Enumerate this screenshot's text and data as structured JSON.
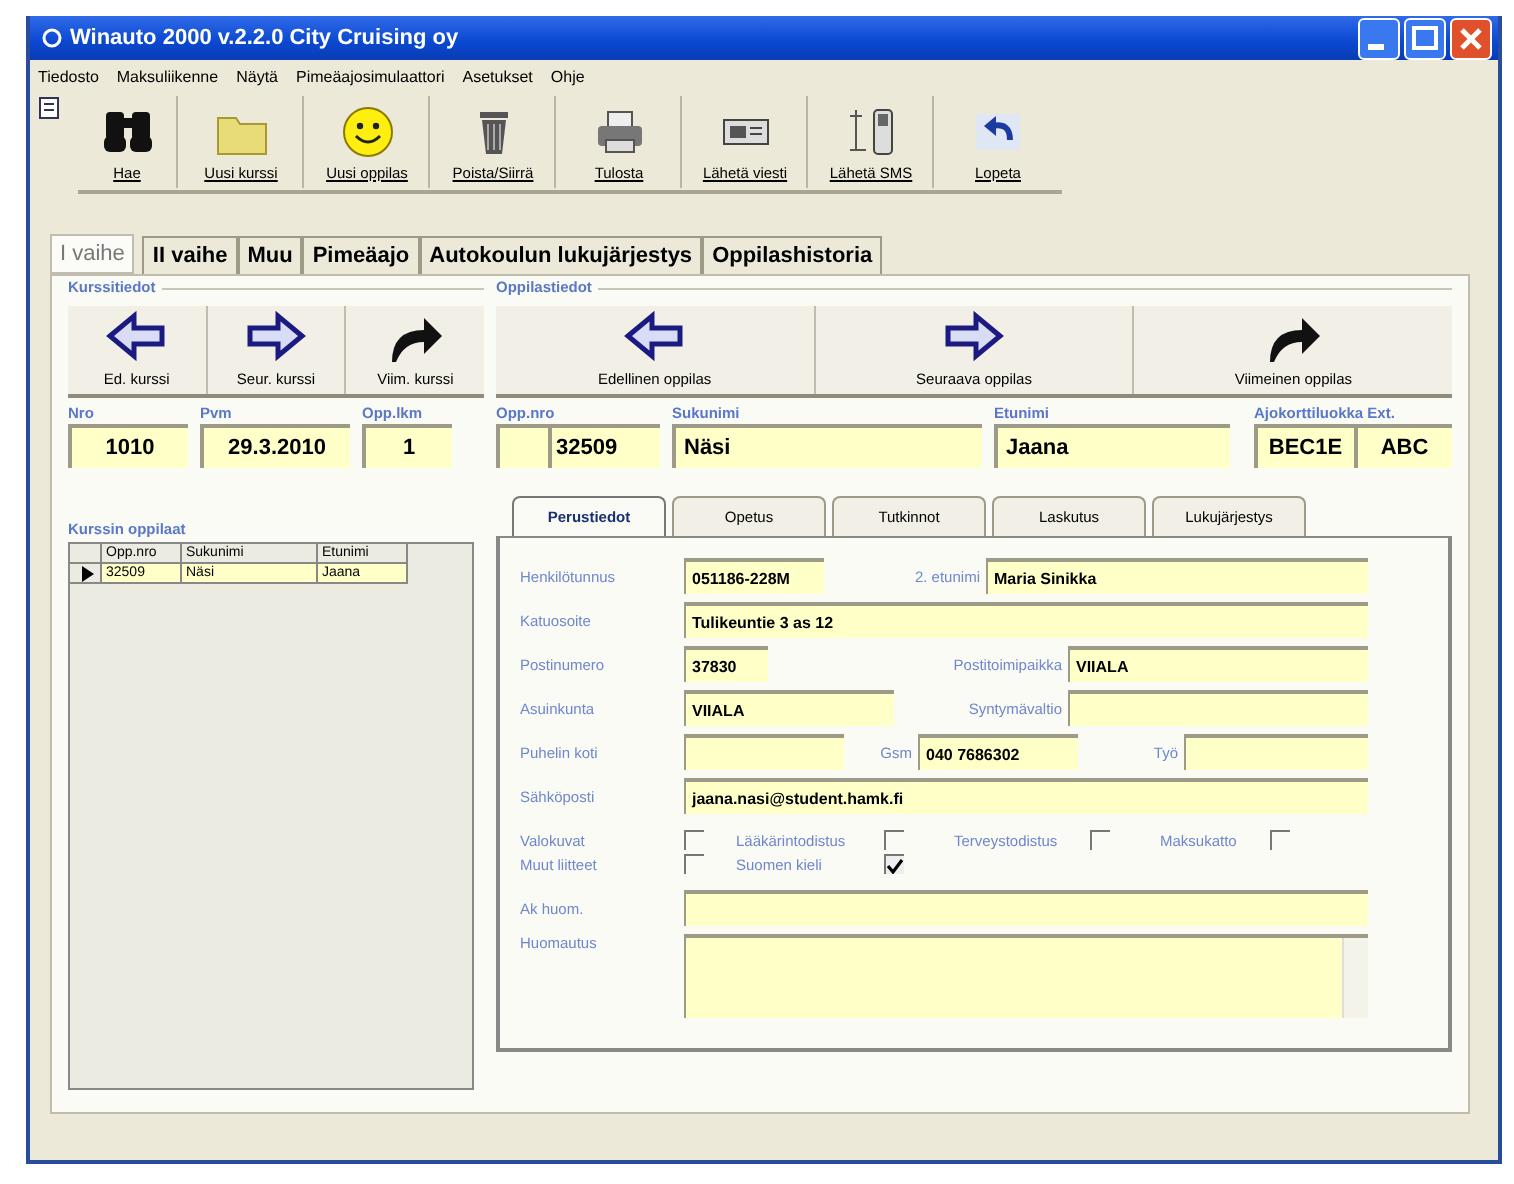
{
  "window": {
    "title": "Winauto 2000 v.2.2.0  City Cruising oy"
  },
  "menu": [
    "Tiedosto",
    "Maksuliikenne",
    "Näytä",
    "Pimeäajosimulaattori",
    "Asetukset",
    "Ohje"
  ],
  "toolbar": [
    {
      "kind": "search",
      "label": "Hae"
    },
    {
      "kind": "folder",
      "label": "Uusi kurssi"
    },
    {
      "kind": "smiley",
      "label": "Uusi oppilas"
    },
    {
      "kind": "trash",
      "label": "Poista/Siirrä"
    },
    {
      "kind": "printer",
      "label": "Tulosta"
    },
    {
      "kind": "message",
      "label": "Lähetä viesti"
    },
    {
      "kind": "phone",
      "label": "Lähetä SMS"
    },
    {
      "kind": "undo",
      "label": "Lopeta"
    }
  ],
  "tabs": [
    {
      "label": "I vaihe",
      "selected": true
    },
    {
      "label": "II vaihe",
      "selected": false
    },
    {
      "label": "Muu",
      "selected": false
    },
    {
      "label": "Pimeäajo",
      "selected": false
    },
    {
      "label": "Autokoulun lukujärjestys",
      "selected": false
    },
    {
      "label": "Oppilashistoria",
      "selected": false
    }
  ],
  "course": {
    "title": "Kurssitiedot",
    "buttons": [
      {
        "kind": "prev",
        "label": "Ed. kurssi"
      },
      {
        "kind": "next",
        "label": "Seur. kurssi"
      },
      {
        "kind": "last",
        "label": "Viim. kurssi"
      }
    ],
    "fields": [
      {
        "label": "Nro",
        "value": "1010"
      },
      {
        "label": "Pvm",
        "value": "29.3.2010"
      },
      {
        "label": "Opp.lkm",
        "value": "1"
      }
    ],
    "students": {
      "title": "Kurssin oppilaat",
      "columns": [
        "Opp.nro",
        "Sukunimi",
        "Etunimi"
      ],
      "rows": [
        {
          "cells": [
            "32509",
            "Näsi",
            "Jaana"
          ],
          "selected": true
        }
      ]
    }
  },
  "student": {
    "title": "Oppilastiedot",
    "buttons": [
      {
        "kind": "prev",
        "label": "Edellinen oppilas"
      },
      {
        "kind": "next",
        "label": "Seuraava oppilas"
      },
      {
        "kind": "last",
        "label": "Viimeinen oppilas"
      }
    ],
    "fields": [
      {
        "label": "Opp.nro",
        "value": "32509"
      },
      {
        "label": "Sukunimi",
        "value": "Näsi"
      },
      {
        "label": "Etunimi",
        "value": "Jaana"
      }
    ],
    "license": {
      "label": "Ajokorttiluokka Ext.",
      "value": "BEC1E",
      "ext_value": "ABC"
    },
    "tabs": [
      {
        "label": "Perustiedot",
        "selected": true
      },
      {
        "label": "Opetus",
        "selected": false
      },
      {
        "label": "Tutkinnot",
        "selected": false
      },
      {
        "label": "Laskutus",
        "selected": false
      },
      {
        "label": "Lukujärjestys",
        "selected": false
      }
    ],
    "form_rows": [
      [
        {
          "label": "Henkilötunnus",
          "value": "051186-228M"
        },
        {
          "label": "2. etunimi",
          "value": "Maria Sinikka"
        }
      ],
      [
        {
          "label": "Katuosoite",
          "value": "Tulikeuntie 3 as 12"
        }
      ],
      [
        {
          "label": "Postinumero",
          "value": "37830"
        },
        {
          "label": "Postitoimipaikka",
          "value": "VIIALA"
        }
      ],
      [
        {
          "label": "Asuinkunta",
          "value": "VIIALA"
        },
        {
          "label": "Syntymävaltio"
        }
      ],
      [
        {
          "label": "Puhelin koti"
        },
        {
          "label": "Gsm",
          "value": "040 7686302"
        },
        {
          "label": "Työ"
        }
      ],
      [
        {
          "label": "Sähköposti",
          "value": "jaana.nasi@student.hamk.fi"
        }
      ]
    ],
    "checkboxes": [
      {
        "label": "Valokuvat",
        "checked": false
      },
      {
        "label": "Lääkärintodistus",
        "checked": false
      },
      {
        "label": "Terveystodistus",
        "checked": false
      },
      {
        "label": "Maksukatto",
        "checked": false
      },
      {
        "label": "Muut liitteet",
        "checked": false
      },
      {
        "label": "Suomen kieli",
        "checked": true
      }
    ],
    "notes": [
      {
        "label": "Ak huom."
      },
      {
        "label": "Huomautus",
        "kind": "multiline"
      }
    ]
  }
}
